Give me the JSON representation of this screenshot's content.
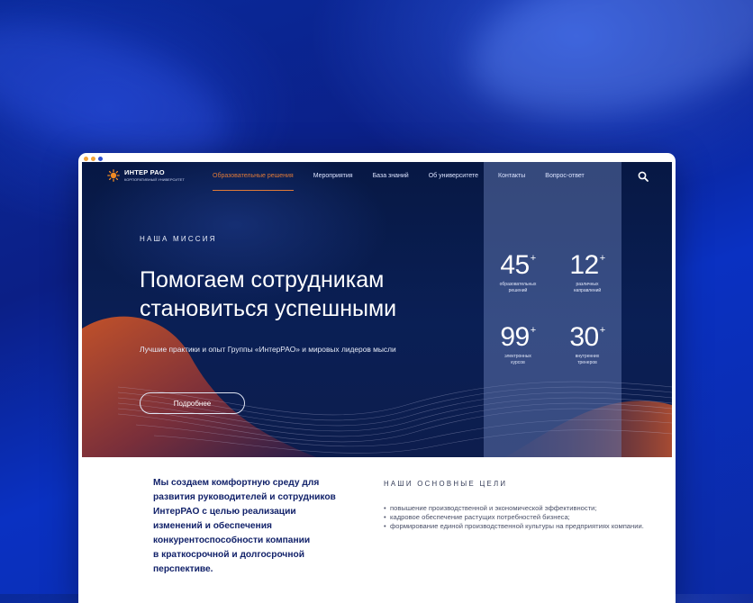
{
  "colors": {
    "accent": "#e07a38",
    "hero_bg": "#0a1f55",
    "lower_heading": "#12226a",
    "page_bg": "#0b2aa6"
  },
  "window": {
    "dots": [
      "#f2a33a",
      "#f2a33a",
      "#2b4fd1"
    ]
  },
  "header": {
    "logo": {
      "main": "ИНТЕР РАО",
      "sub": "КОРПОРАТИВНЫЙ УНИВЕРСИТЕТ",
      "icon": "sun-logo-icon"
    },
    "nav": [
      {
        "label": "Образовательные решения",
        "active": true
      },
      {
        "label": "Мероприятия",
        "active": false
      },
      {
        "label": "База знаний",
        "active": false
      },
      {
        "label": "Об университете",
        "active": false
      },
      {
        "label": "Контакты",
        "active": false
      },
      {
        "label": "Вопрос-ответ",
        "active": false
      }
    ],
    "search_icon": "search-icon"
  },
  "hero": {
    "eyebrow": "НАША МИССИЯ",
    "title_line1": "Помогаем сотрудникам",
    "title_line2": "становиться успешными",
    "subtitle": "Лучшие практики и опыт Группы «ИнтерРАО» и мировых лидеров мысли",
    "button": "Подробнее"
  },
  "stats": [
    {
      "number": "45",
      "suffix": "+",
      "label1": "образовательных",
      "label2": "решений"
    },
    {
      "number": "12",
      "suffix": "+",
      "label1": "различных",
      "label2": "направлений"
    },
    {
      "number": "99",
      "suffix": "+",
      "label1": "электронных",
      "label2": "курсов"
    },
    {
      "number": "30",
      "suffix": "+",
      "label1": "внутренних",
      "label2": "тренеров"
    }
  ],
  "lower": {
    "left_lines": [
      "Мы создаем комфортную среду для",
      "развития руководителей и сотрудников",
      "ИнтерРАО с целью реализации",
      "изменений и обеспечения",
      "конкурентоспособности компании",
      "в краткосрочной и долгосрочной",
      "перспективе."
    ],
    "goals_title": "НАШИ ОСНОВНЫЕ ЦЕЛИ",
    "goals": [
      "повышение производственной и экономической эффективности;",
      "кадровое обеспечение растущих потребностей бизнеса;",
      "формирование единой производственной культуры на предприятиях компании."
    ]
  }
}
